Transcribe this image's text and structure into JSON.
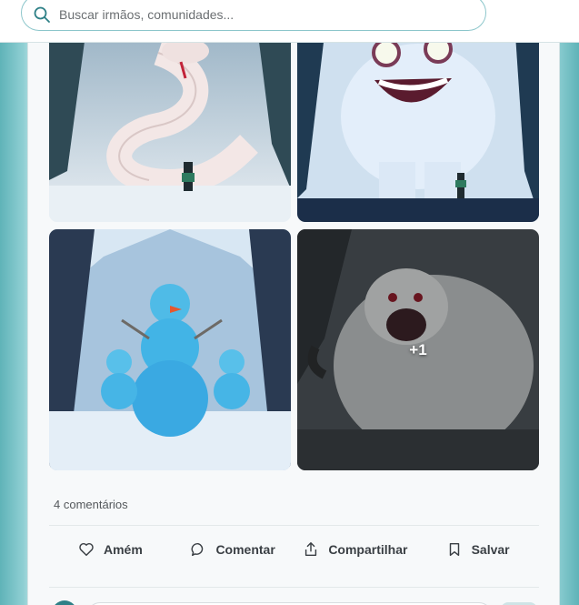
{
  "search": {
    "placeholder": "Buscar irmãos, comunidades..."
  },
  "icons": {
    "search": "search-icon",
    "like": "heart-icon",
    "comment": "comment-bubble-icon",
    "share": "share-upload-icon",
    "save": "bookmark-icon"
  },
  "post": {
    "gallery": {
      "tiles": [
        {
          "subject": "white-serpent"
        },
        {
          "subject": "snow-giant"
        },
        {
          "subject": "ice-snowmen"
        },
        {
          "subject": "snow-ape",
          "overlay": "+1"
        }
      ]
    },
    "comments_count": "4 comentários",
    "actions": {
      "amen": "Amém",
      "comment": "Comentar",
      "share": "Compartilhar",
      "save": "Salvar"
    }
  },
  "colors": {
    "accent": "#2e8087",
    "border": "#8cc6cb"
  }
}
